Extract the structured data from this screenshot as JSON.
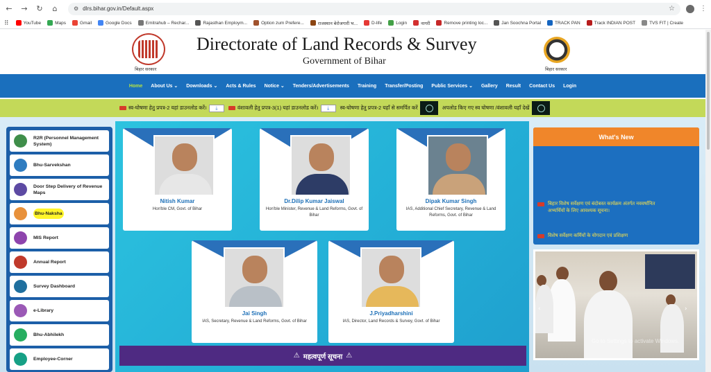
{
  "browser": {
    "url": "dlrs.bihar.gov.in/Default.aspx",
    "bookmarks": [
      "YouTube",
      "Maps",
      "Gmail",
      "Google Docs",
      "Emitrahub – Rechar...",
      "Rajasthan Employm...",
      "Option zum Prefere...",
      "राजस्थान बेरोजगारी भ...",
      "D-life",
      "Login",
      "नागरी",
      "Remove printing loc...",
      "Jan Soochna Portal",
      "TRACK PAN",
      "Track INDIAN POST",
      "TVS FIT | Create"
    ],
    "bookmark_colors": [
      "#ff0000",
      "#34a853",
      "#ea4335",
      "#4285f4",
      "#777777",
      "#555555",
      "#a0522d",
      "#8b4513",
      "#e53935",
      "#43a047",
      "#d32f2f",
      "#c62828",
      "#555555",
      "#1565c0",
      "#b71c1c",
      "#888888"
    ]
  },
  "header": {
    "title": "Directorate of Land Records & Survey",
    "subtitle": "Government of Bihar",
    "left_emblem_caption": "बिहार सरकार",
    "right_emblem_caption": "बिहार सरकार"
  },
  "nav": {
    "items": [
      "Home",
      "About Us ⌄",
      "Downloads ⌄",
      "Acts & Rules",
      "Notice ⌄",
      "Tenders/Advertisements",
      "Training",
      "Transfer/Posting",
      "Public Services ⌄",
      "Gallery",
      "Result",
      "Contact Us",
      "Login"
    ]
  },
  "ticker": {
    "items": [
      "स्व-घोषणा हेतु प्रपत्र-2 यहां डाउनलोड करें।",
      "वंशावली हेतु प्रपत्र-3(1) यहां डाउनलोड करें।",
      "स्व-घोषणा हेतु प्रपत्र-2 यहाँ से समर्पित करें",
      "अपलोड किए गए स्व घोषणा /वंशावली यहाँ देखें"
    ],
    "download_glyph": "⤓"
  },
  "sidebar": {
    "items": [
      {
        "label": "R2R (Personnel Management System)",
        "color": "#3f8e4a"
      },
      {
        "label": "Bhu-Sarvekshan",
        "color": "#2f7cc0"
      },
      {
        "label": "Door Step Delivery of Revenue Maps",
        "color": "#5d4aa3"
      },
      {
        "label": "Bhu-Naksha",
        "color": "#e8913b"
      },
      {
        "label": "MIS Report",
        "color": "#8e44ad"
      },
      {
        "label": "Annual Report",
        "color": "#c0392b"
      },
      {
        "label": "Survey Dashboard",
        "color": "#1f6f9e"
      },
      {
        "label": "e-Library",
        "color": "#9b59b6"
      },
      {
        "label": "Bhu-Abhilekh",
        "color": "#27ae60"
      },
      {
        "label": "Employee-Corner",
        "color": "#16a085"
      }
    ]
  },
  "officials": [
    {
      "name": "Nitish Kumar",
      "designation": "Hon'ble CM, Govt. of Bihar"
    },
    {
      "name": "Dr.Dilip Kumar Jaiswal",
      "designation": "Hon'ble Minister, Revenue & Land Reforms, Govt. of Bihar"
    },
    {
      "name": "Dipak Kumar Singh",
      "designation": "IAS, Additional Chief Secretary, Revenue & Land Reforms, Govt. of Bihar"
    },
    {
      "name": "Jai Singh",
      "designation": "IAS, Secretary, Revenue & Land Reforms, Govt. of Bihar"
    },
    {
      "name": "J.Priyadharshini",
      "designation": "IAS, Director, Land Records & Survey, Govt. of Bihar"
    }
  ],
  "notice": {
    "title": "महत्वपूर्ण सूचना"
  },
  "whats_new": {
    "title": "What's New",
    "items": [
      "बिहार विशेष सर्वेक्षण एवं बंदोबस्त कार्यक्रम अंतर्गत नववर्षानित अभ्यर्थियों के लिए आवश्यक सूचना।",
      "विशेष सर्वेक्षण कर्मियों के योगदान एवं प्रशिक्षण"
    ]
  },
  "watermark": "Go to Settings to activate Windows."
}
